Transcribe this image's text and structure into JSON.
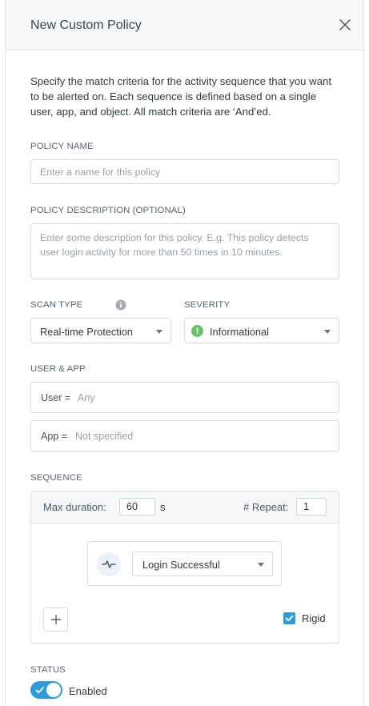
{
  "header": {
    "title": "New Custom Policy",
    "close_icon": "close-icon"
  },
  "intro": "Specify the match criteria for the activity sequence that you want to be alerted on. Each sequence is defined based on a single user, app, and object. All match criteria are ‘And’ed.",
  "policy_name": {
    "label": "POLICY NAME",
    "value": "",
    "placeholder": "Enter a name for this policy"
  },
  "policy_description": {
    "label": "POLICY DESCRIPTION (OPTIONAL)",
    "value": "",
    "placeholder": "Enter some description for this policy. E.g. This policy detects user login activity for more than 50 times in 10 minutes."
  },
  "scan_type": {
    "label": "SCAN TYPE",
    "info_icon": "info-icon",
    "selected": "Real-time Protection"
  },
  "severity": {
    "label": "SEVERITY",
    "selected": "Informational",
    "indicator_color": "#6cbf6a"
  },
  "user_app": {
    "label": "USER & APP",
    "user": {
      "key": "User =",
      "value": "Any"
    },
    "app": {
      "key": "App =",
      "value": "Not specified"
    }
  },
  "sequence": {
    "label": "SEQUENCE",
    "max_duration_label": "Max duration:",
    "max_duration_value": "60",
    "max_duration_unit": "s",
    "repeat_label": "# Repeat:",
    "repeat_value": "1",
    "event": {
      "icon": "activity-pulse-icon",
      "selected": "Login Successful"
    },
    "add_icon": "plus-icon",
    "rigid_label": "Rigid",
    "rigid_checked": true
  },
  "status": {
    "label": "STATUS",
    "toggle_label": "Enabled",
    "enabled": true
  },
  "colors": {
    "accent": "#2e9bd6",
    "header_bg": "#f6f7f8",
    "border": "#d6dade"
  }
}
